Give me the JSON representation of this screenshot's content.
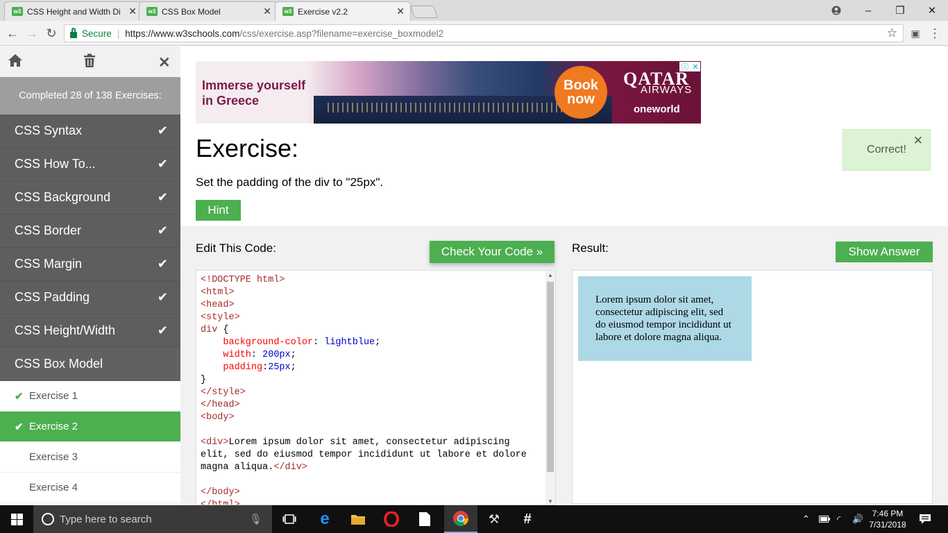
{
  "browser": {
    "tabs": [
      {
        "title": "CSS Height and Width Di",
        "favicon": "w3"
      },
      {
        "title": "CSS Box Model",
        "favicon": "w3"
      },
      {
        "title": "Exercise v2.2",
        "favicon": "w3"
      }
    ],
    "secure_label": "Secure",
    "url_host": "https://www.w3schools.com",
    "url_path": "/css/exercise.asp?filename=exercise_boxmodel2"
  },
  "sidebar": {
    "progress": "Completed 28 of 138 Exercises:",
    "categories": [
      {
        "label": "CSS Syntax",
        "done": true
      },
      {
        "label": "CSS How To...",
        "done": true
      },
      {
        "label": "CSS Background",
        "done": true
      },
      {
        "label": "CSS Border",
        "done": true
      },
      {
        "label": "CSS Margin",
        "done": true
      },
      {
        "label": "CSS Padding",
        "done": true
      },
      {
        "label": "CSS Height/Width",
        "done": true
      }
    ],
    "current_category": "CSS Box Model",
    "exercises": [
      {
        "label": "Exercise 1",
        "done": true
      },
      {
        "label": "Exercise 2",
        "done": true
      },
      {
        "label": "Exercise 3",
        "done": false
      },
      {
        "label": "Exercise 4",
        "done": false
      }
    ]
  },
  "ad": {
    "headline": "Immerse yourself in Greece",
    "cta": "Book now",
    "brand": "QATAR",
    "brand_sub": "AIRWAYS",
    "alliance": "oneworld"
  },
  "exercise": {
    "title": "Exercise:",
    "description": "Set the padding of the div to \"25px\".",
    "hint_label": "Hint",
    "correct_message": "Correct!",
    "edit_label": "Edit This Code:",
    "check_label": "Check Your Code »",
    "result_label": "Result:",
    "show_answer_label": "Show Answer",
    "code": "<!DOCTYPE html>\n<html>\n<head>\n<style>\ndiv {\n    background-color: lightblue;\n    width: 200px;\n    padding:25px;\n}\n</style>\n</head>\n<body>\n\n<div>Lorem ipsum dolor sit amet, consectetur adipiscing\nelit, sed do eiusmod tempor incididunt ut labore et dolore\nmagna aliqua.</div>\n\n</body>\n</html>",
    "result_text": "Lorem ipsum dolor sit amet, consectetur adipiscing elit, sed do eiusmod tempor incididunt ut labore et dolore magna aliqua."
  },
  "taskbar": {
    "search_placeholder": "Type here to search",
    "time": "7:46 PM",
    "date": "7/31/2018"
  },
  "colors": {
    "accent_green": "#4caf50",
    "sidebar_dark": "#5e5e5e",
    "result_bg": "#add8e6"
  }
}
